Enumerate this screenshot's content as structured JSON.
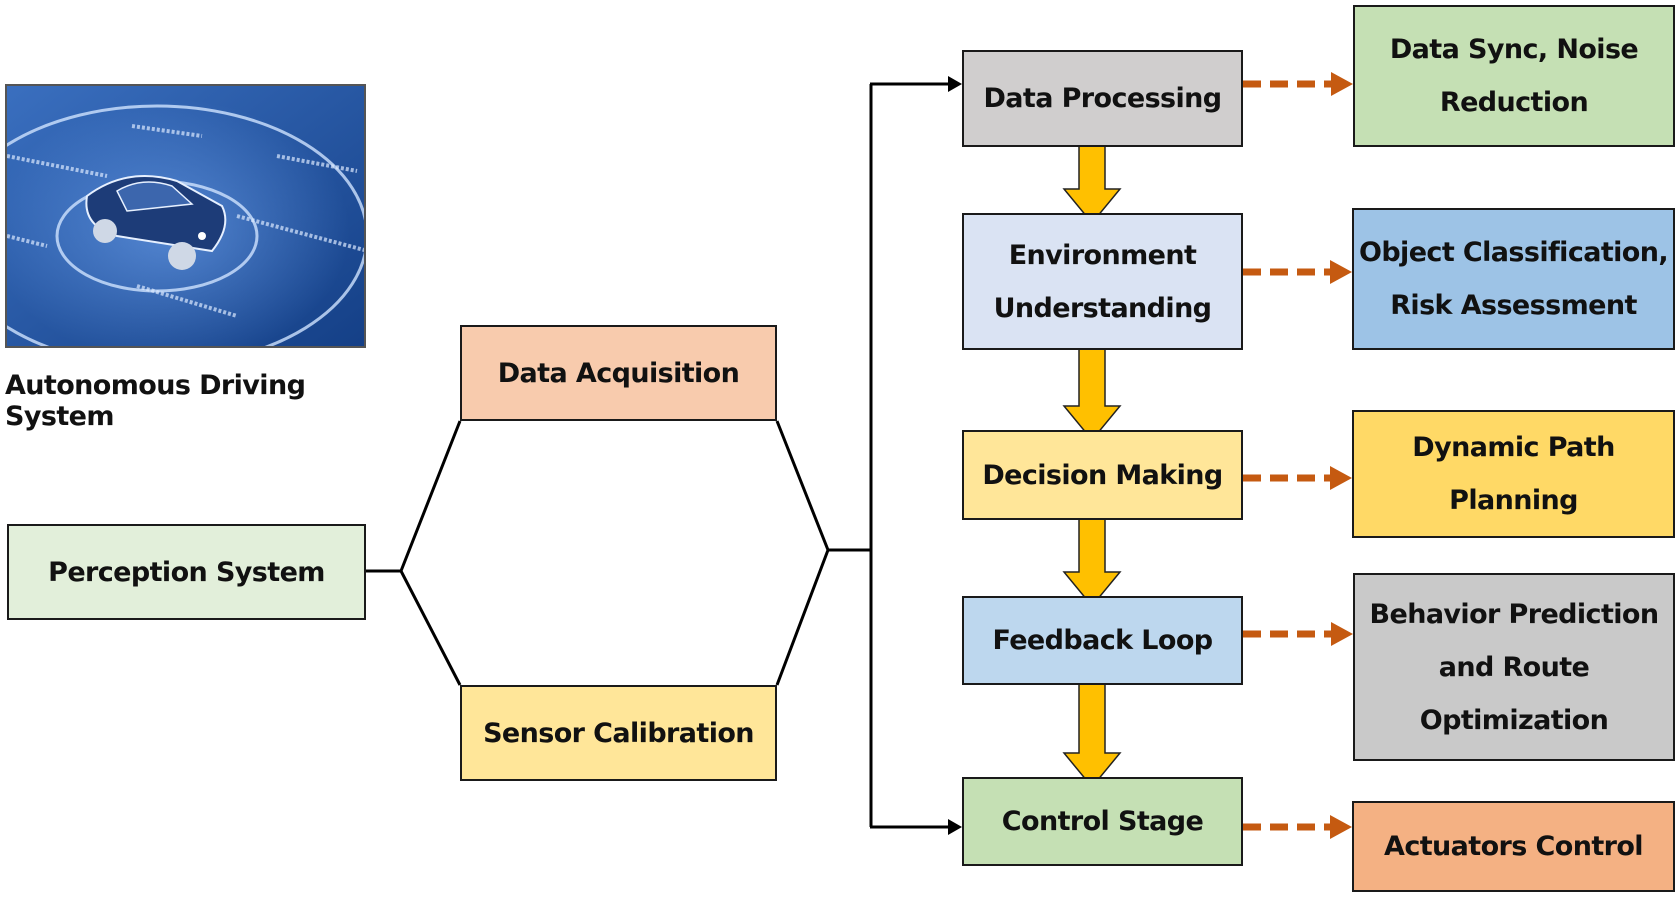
{
  "title": "Autonomous Driving System",
  "hero_image": {
    "caption": "Autonomous Driving System",
    "icon": "car-sensor-radar-illustration"
  },
  "root": {
    "label": "Perception System",
    "color": "#E2EFDA"
  },
  "branches": [
    {
      "label": "Data Acquisition",
      "color": "#F8CBAD"
    },
    {
      "label": "Sensor Calibration",
      "color": "#FFE699"
    }
  ],
  "pipeline": [
    {
      "lines": [
        "Data Processing"
      ],
      "color": "#D0CECE"
    },
    {
      "lines": [
        "Environment",
        "Understanding"
      ],
      "color": "#DAE3F3"
    },
    {
      "lines": [
        "Decision Making"
      ],
      "color": "#FFE699"
    },
    {
      "lines": [
        "Feedback Loop"
      ],
      "color": "#BDD7EE"
    },
    {
      "lines": [
        "Control Stage"
      ],
      "color": "#C5E0B4"
    }
  ],
  "outputs": [
    {
      "lines": [
        "Data Sync, Noise",
        "Reduction"
      ],
      "color": "#C5E0B4"
    },
    {
      "lines": [
        "Object Classification,",
        "Risk Assessment"
      ],
      "color": "#9DC3E6"
    },
    {
      "lines": [
        "Dynamic Path",
        "Planning"
      ],
      "color": "#FFD966"
    },
    {
      "lines": [
        "Behavior Prediction",
        "and Route",
        "Optimization"
      ],
      "color": "#C9C9C9"
    },
    {
      "lines": [
        "Actuators Control"
      ],
      "color": "#F4B183"
    }
  ],
  "colors": {
    "flow_arrow": "#FFC000",
    "dashed_arrow": "#C55A11",
    "line": "#000000"
  }
}
